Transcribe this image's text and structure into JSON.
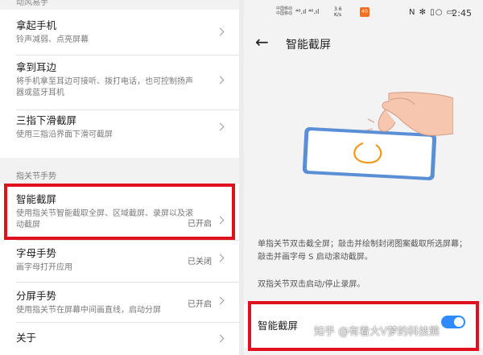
{
  "left": {
    "top_cut_label": "动风易手",
    "rows": [
      {
        "title": "拿起手机",
        "desc": "铃声减弱、点亮屏幕",
        "status": ""
      },
      {
        "title": "拿到耳边",
        "desc": "将手机拿至耳边可接听、拨打电话，也可控制扬声器或蓝牙耳机",
        "status": ""
      },
      {
        "title": "三指下滑截屏",
        "desc": "使用三指沿界面下滑可截屏",
        "status": ""
      }
    ],
    "section_label": "指关节手势",
    "gesture_rows": [
      {
        "title": "智能截屏",
        "desc": "使用指关节智能截取全屏、区域截屏、录屏以及滚动截屏",
        "status": "已开启"
      },
      {
        "title": "字母手势",
        "desc": "画字母打开应用",
        "status": "已关闭"
      },
      {
        "title": "分屏手势",
        "desc": "使用指关节在屏幕中间画直线，启动分屏",
        "status": "已开启"
      },
      {
        "title": "关于",
        "desc": "",
        "status": ""
      }
    ]
  },
  "right": {
    "status_bar": {
      "carrier1": "中国移动",
      "carrier2": "中国移动",
      "signal_text": "⁴⁶.ıl ⁴⁶.ıl",
      "speed": "3.6 K/s",
      "badge": "40",
      "icons": "N ✻ ▯○ ▭",
      "time": "2:45"
    },
    "title": "智能截屏",
    "desc1": "单指关节双击截全屏；敲击并绘制封闭图案截取所选屏幕；敲击并画字母 S 启动滚动截屏。",
    "desc2": "双指关节双击启动/停止录屏。",
    "toggle_label": "智能截屏",
    "toggle_on": true,
    "accent_color": "#2f8bff",
    "highlight_color": "#e0101e"
  },
  "watermark": "知乎 @有着大V梦的科技熊"
}
